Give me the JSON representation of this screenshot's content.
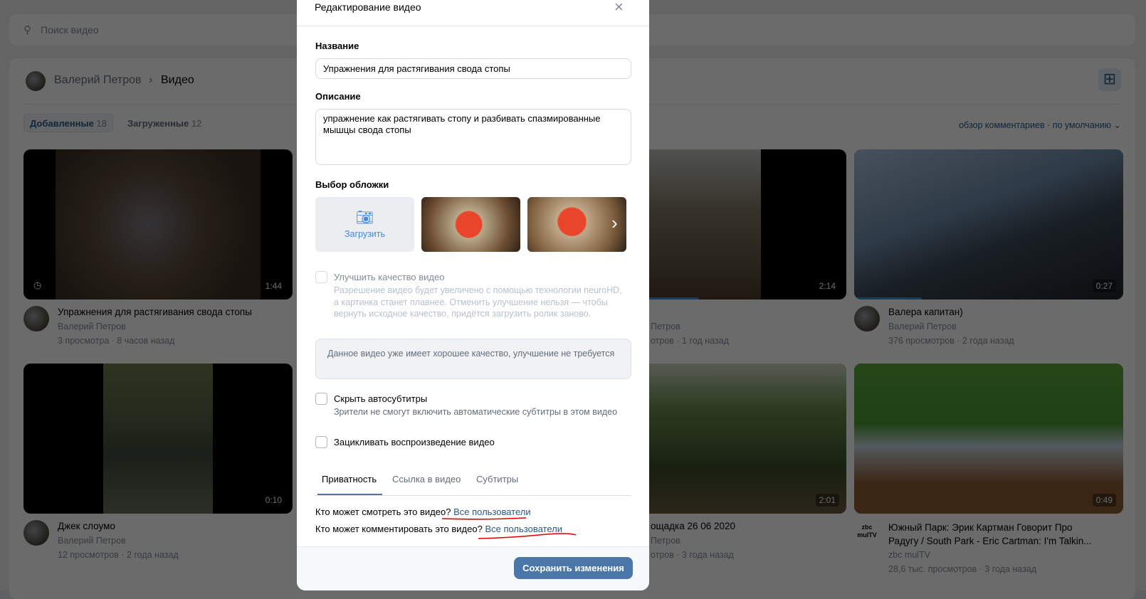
{
  "search": {
    "placeholder": "Поиск видео",
    "icon": "search-icon"
  },
  "header": {
    "user": "Валерий Петров",
    "section": "Видео"
  },
  "tabs": [
    {
      "label": "Добавленные",
      "count": "18"
    },
    {
      "label": "Загруженные",
      "count": "12"
    }
  ],
  "sort": {
    "comments": "обзор комментариев",
    "order": "по умолчанию"
  },
  "videos": [
    {
      "title": "Упражнения для растягивания свода стопы",
      "author": "Валерий Петров",
      "stats": "3 просмотра · 8 часов назад",
      "duration": "1:44"
    },
    {
      "title": "",
      "author": "Петров",
      "stats": "отров · 1 год назад",
      "duration": "2:14"
    },
    {
      "title": "Валера капитан)",
      "author": "Валерий Петров",
      "stats": "376 просмотров · 2 года назад",
      "duration": "0:27"
    },
    {
      "title": "Джек слоумо",
      "author": "Валерий Петров",
      "stats": "12 просмотров · 2 года назад",
      "duration": "0:10"
    },
    {
      "title": "ощадка 26 06 2020",
      "author": "Петров",
      "stats": "отров · 3 года назад",
      "duration": "2:01"
    },
    {
      "title": "Южный Парк: Эрик Картман Говорит Про Радугу / South Park - Eric Cartman: I'm Talkin...",
      "author": "zbc mulTV",
      "stats": "28,6 тыс. просмотров · 3 года назад",
      "duration": "0:49",
      "avatar_text": "zbc mulTV"
    }
  ],
  "modal": {
    "title": "Редактирование видео",
    "name_label": "Название",
    "name_value": "Упражнения для растягивания свода стопы",
    "desc_label": "Описание",
    "desc_value": "упражнение как растягивать стопу и разбивать спазмированные мышцы свода стопы",
    "cover_label": "Выбор обложки",
    "upload": "Загрузить",
    "enhance_label": "Улучшить качество видео",
    "enhance_desc": "Разрешение видео будет увеличено с помощью технологии neuroHD, а картинка станет плавнее. Отменить улучшение нельзя — чтобы вернуть исходное качество, придётся загрузить ролик заново.",
    "enhance_note": "Данное видео уже имеет хорошее качество, улучшение не требуется",
    "hide_subs_label": "Скрыть автосубтитры",
    "hide_subs_desc": "Зрители не смогут включить автоматические субтитры в этом видео",
    "loop_label": "Зацикливать воспроизведение видео",
    "tabs": [
      "Приватность",
      "Ссылка в видео",
      "Субтитры"
    ],
    "view_q": "Кто может смотреть это видео?",
    "view_a": "Все пользователи",
    "comment_q": "Кто может комментировать это видео?",
    "comment_a": "Все пользователи",
    "save": "Сохранить изменения"
  },
  "colors": {
    "accent": "#4a76a8",
    "link": "#2a5885",
    "annotation": "#e00000"
  }
}
